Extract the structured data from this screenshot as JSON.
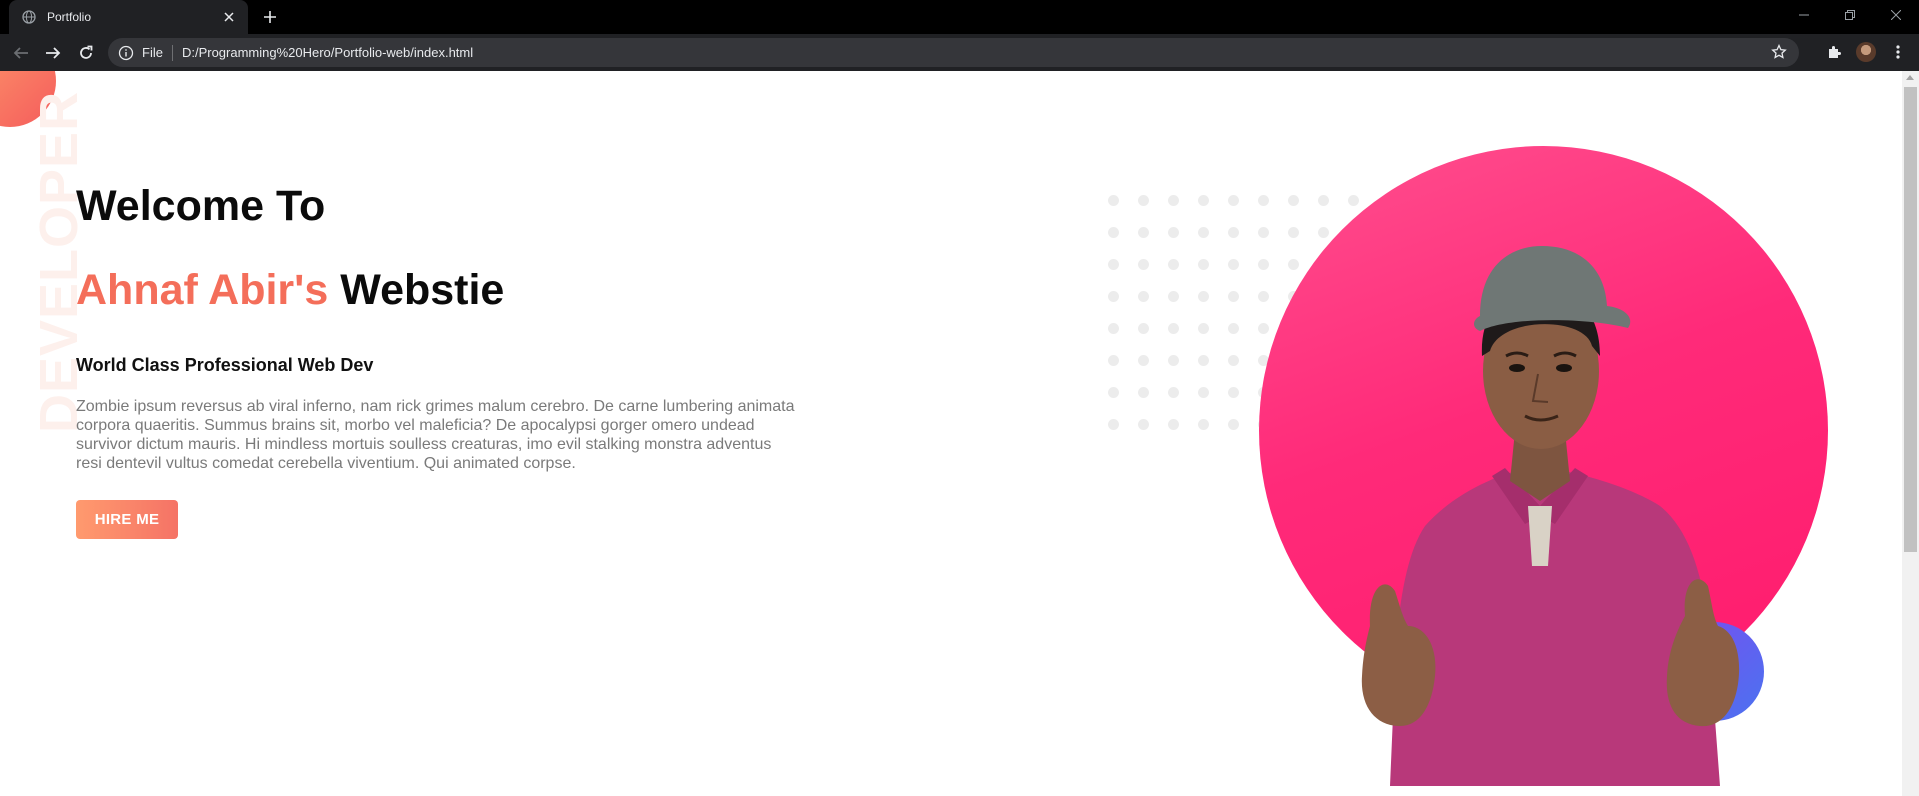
{
  "browser": {
    "tab_title": "Portfolio",
    "omnibox_scheme_label": "File",
    "url": "D:/Programming%20Hero/Portfolio-web/index.html",
    "icons": [
      "globe-icon",
      "close-icon",
      "plus-icon",
      "minimize-icon",
      "restore-icon",
      "window-close-icon",
      "back-arrow-icon",
      "forward-arrow-icon",
      "reload-icon",
      "info-icon",
      "star-icon",
      "puzzle-icon",
      "profile-avatar",
      "kebab-menu-icon"
    ]
  },
  "page": {
    "side_word": "DEVELOPER",
    "title_line1": "Welcome To",
    "title_accent": "Ahnaf Abir's",
    "title_rest": " Webstie",
    "subtitle": "World Class Professional Web Dev",
    "body": "Zombie ipsum reversus ab viral inferno, nam rick grimes malum cerebro. De carne lumbering animata corpora quaeritis. Summus brains sit, morbo vel maleficia? De apocalypsi gorger omero undead survivor dictum mauris. Hi mindless mortuis soulless creaturas, imo evil stalking monstra adventus resi dentevil vultus comedat cerebella viventium. Qui animated corpse.",
    "cta_label": "HIRE ME"
  },
  "colors": {
    "accent": "#f46e5a",
    "portrait_ring": "#ff2a79",
    "portrait_badge": "#5b62f0",
    "button_gradient_start": "#ff9a6e",
    "button_gradient_end": "#f57366"
  }
}
